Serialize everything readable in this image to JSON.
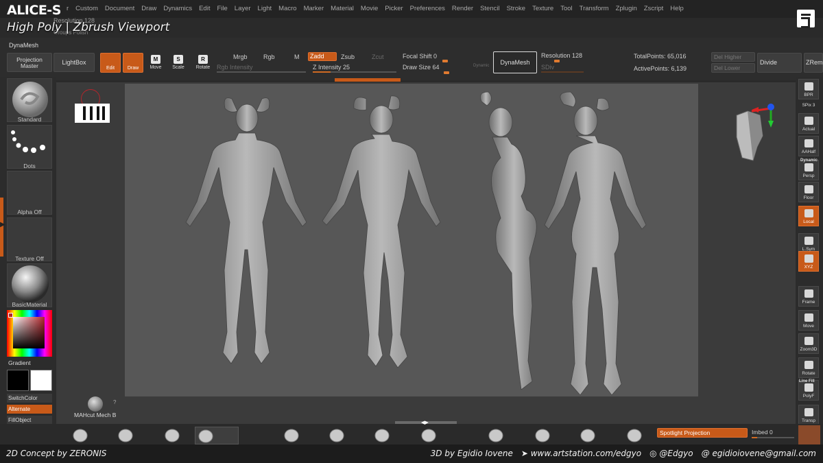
{
  "header": {
    "logo": "ALICE-S",
    "title": "High Poly | Zbrush Viewport",
    "resolution_ghost": "Resolution 128",
    "groups_ghost": "Groups  Polish"
  },
  "menu": [
    "r",
    "Custom",
    "Document",
    "Draw",
    "Dynamics",
    "Edit",
    "File",
    "Layer",
    "Light",
    "Macro",
    "Marker",
    "Material",
    "Movie",
    "Picker",
    "Preferences",
    "Render",
    "Stencil",
    "Stroke",
    "Texture",
    "Tool",
    "Transform",
    "Zplugin",
    "Zscript",
    "Help"
  ],
  "toolbar": {
    "dynamesh_label": "DynaMesh",
    "projection_master": "Projection Master",
    "lightbox": "LightBox",
    "edit": "Edit",
    "draw": "Draw",
    "move": "Move",
    "scale": "Scale",
    "rotate": "Rotate",
    "mrgb": "Mrgb",
    "rgb": "Rgb",
    "m": "M",
    "rgb_intensity": "Rgb Intensity",
    "zadd": "Zadd",
    "zsub": "Zsub",
    "zcut": "Zcut",
    "z_intensity": "Z Intensity 25",
    "focal_shift": "Focal Shift 0",
    "draw_size": "Draw Size 64",
    "dynamic": "Dynamic",
    "dynamesh_btn": "DynaMesh",
    "resolution": "Resolution 128",
    "sdiv": "SDiv",
    "total_points": "TotalPoints: 65,016",
    "active_points": "ActivePoints: 6,139",
    "del_higher": "Del Higher",
    "del_lower": "Del Lower",
    "divide": "Divide",
    "zremesh": "ZRem"
  },
  "left": {
    "standard": "Standard",
    "dots": "Dots",
    "alpha_off": "Alpha Off",
    "texture_off": "Texture Off",
    "basic_material": "BasicMaterial",
    "gradient": "Gradient",
    "switch_color": "SwitchColor",
    "alternate": "Alternate",
    "fill_object": "FillObject"
  },
  "bottom": {
    "material_name": "MAHcut Mech B",
    "question": "?",
    "spotlight": "Spotlight Projection",
    "imbed": "Imbed 0"
  },
  "right": [
    {
      "label": "BPR",
      "icon": "bpr-icon",
      "active": false
    },
    {
      "label": "SPix 3",
      "icon": "spix-icon",
      "active": false
    },
    {
      "label": "Actual",
      "icon": "actual-icon",
      "active": false
    },
    {
      "label": "AAHalf",
      "icon": "aahalf-icon",
      "active": false
    },
    {
      "label": "Persp",
      "icon": "persp-icon",
      "active": false
    },
    {
      "label": "Floor",
      "icon": "floor-icon",
      "active": false
    },
    {
      "label": "Local",
      "icon": "local-icon",
      "active": true
    },
    {
      "label": "L.Sym",
      "icon": "lsym-icon",
      "active": false
    },
    {
      "label": "XYZ",
      "icon": "xyz-icon",
      "active": true
    },
    {
      "label": "Frame",
      "icon": "frame-icon",
      "active": false
    },
    {
      "label": "Move",
      "icon": "move-icon",
      "active": false
    },
    {
      "label": "Zoom3D",
      "icon": "zoom3d-icon",
      "active": false
    },
    {
      "label": "Rotate",
      "icon": "rotate-icon",
      "active": false
    },
    {
      "label": "PolyF",
      "icon": "polyf-icon",
      "active": false
    },
    {
      "label": "Transp",
      "icon": "transp-icon",
      "active": false
    }
  ],
  "right_extra": {
    "dynamic": "Dynamic",
    "line_fill": "Line Fill"
  },
  "footer": {
    "concept": "2D Concept by ZERONIS",
    "credit": "3D by Egidio Iovene",
    "site": "www.artstation.com/edgyo",
    "instagram": "@Edgyo",
    "email": "egidioiovene@gmail.com"
  },
  "colors": {
    "accent": "#c85a19",
    "panel": "#2c2c2c",
    "viewport": "#575757"
  }
}
